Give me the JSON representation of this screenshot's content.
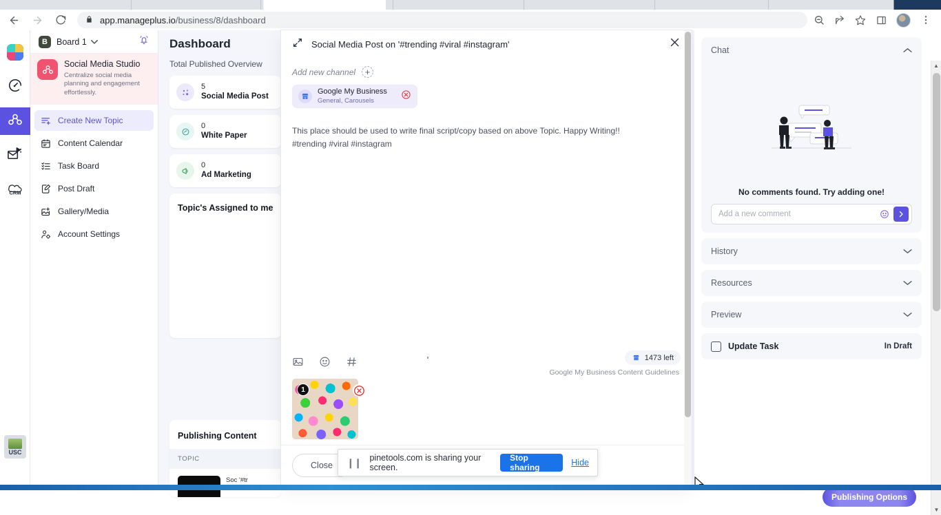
{
  "browser": {
    "url_host": "app.manageplus.io",
    "url_path": "/business/8/dashboard",
    "back_icon": "back-arrow-icon",
    "forward_icon": "forward-arrow-icon",
    "reload_icon": "reload-icon",
    "lock_icon": "lock-icon",
    "zoom_icon": "zoom-out-icon",
    "share_icon": "share-icon",
    "bookmark_icon": "star-icon",
    "sidepanel_icon": "side-panel-icon",
    "profile_icon": "profile-avatar-icon",
    "menu_icon": "three-dot-menu-icon"
  },
  "rail": {
    "items": [
      {
        "icon": "apps-grid-logo-icon",
        "label": "Apps"
      },
      {
        "icon": "speedometer-icon",
        "label": "Dashboard"
      },
      {
        "icon": "social-studio-icon",
        "label": "Social Media Studio"
      },
      {
        "icon": "email-campaign-icon",
        "label": "Email Marketing"
      },
      {
        "icon": "crm-icon",
        "label": "CRM"
      }
    ],
    "bottom_label": "USC"
  },
  "sidebar": {
    "board": {
      "badge": "B",
      "name": "Board 1",
      "caret_icon": "chevron-down-icon",
      "bell_icon": "notification-bell-icon"
    },
    "studio": {
      "icon": "social-studio-icon",
      "title": "Social Media Studio",
      "subtitle": "Centralize social media planning and engagement effortlessly."
    },
    "items": [
      {
        "label": "Create New Topic",
        "icon": "create-topic-icon",
        "active": true
      },
      {
        "label": "Content Calendar",
        "icon": "calendar-icon",
        "active": false
      },
      {
        "label": "Task Board",
        "icon": "task-list-icon",
        "active": false
      },
      {
        "label": "Post Draft",
        "icon": "draft-edit-icon",
        "active": false
      },
      {
        "label": "Gallery/Media",
        "icon": "gallery-add-icon",
        "active": false
      },
      {
        "label": "Account Settings",
        "icon": "account-settings-icon",
        "active": false
      }
    ]
  },
  "dashboard": {
    "title": "Dashboard",
    "subtitle": "Total Published Overview",
    "stats": [
      {
        "count": "5",
        "label": "Social Media Post",
        "icon": "social-post-icon",
        "bg": "#ece9fb",
        "fg": "#6b63e6"
      },
      {
        "count": "0",
        "label": "White Paper",
        "icon": "white-paper-icon",
        "bg": "#e6f6f2",
        "fg": "#3aa08e"
      },
      {
        "count": "0",
        "label": "Ad Marketing",
        "icon": "ad-marketing-icon",
        "bg": "#e6f6ea",
        "fg": "#3f9d5e"
      }
    ],
    "assigned_panel_title": "Topic's Assigned to me",
    "publishing_panel_title": "Publishing Content",
    "publishing_column_header": "TOPIC",
    "publishing_row_text": "Soc '#tr"
  },
  "modal": {
    "expand_icon": "expand-diagonal-icon",
    "title": "Social Media Post on '#trending #viral #instagram'",
    "close_icon": "close-x-icon",
    "add_channel_label": "Add new channel",
    "add_channel_icon": "plus-icon",
    "channel": {
      "icon": "google-my-business-icon",
      "name": "Google My Business",
      "subtitle": "General, Carousels",
      "remove_icon": "remove-circle-icon"
    },
    "editor_line1": "This place should be used to write final script/copy based on above Topic. Happy Writing!!",
    "editor_line2": "#trending #viral #instagram",
    "toolbar": [
      {
        "icon": "image-insert-icon"
      },
      {
        "icon": "emoji-icon"
      },
      {
        "icon": "hashtag-icon"
      }
    ],
    "counter_text": "1473 left",
    "counter_icon": "google-my-business-icon",
    "guidelines_link": "Google My Business Content Guidelines",
    "media": {
      "index": "1",
      "remove_icon": "remove-circle-icon"
    },
    "close_button": "Close"
  },
  "right": {
    "sections": [
      {
        "label": "Chat",
        "caret": "chevron-up-icon",
        "expanded": true
      },
      {
        "label": "History",
        "caret": "chevron-down-icon",
        "expanded": false
      },
      {
        "label": "Resources",
        "caret": "chevron-down-icon",
        "expanded": false
      },
      {
        "label": "Preview",
        "caret": "chevron-down-icon",
        "expanded": false
      }
    ],
    "chat": {
      "empty_illustration": "two-people-chat-illustration",
      "empty_text": "No comments found. Try adding one!",
      "input_placeholder": "Add a new comment",
      "emoji_icon": "emoji-icon",
      "send_icon": "send-arrow-icon"
    },
    "task": {
      "checkbox_icon": "checkbox-unchecked-icon",
      "label": "Update Task",
      "status": "In Draft"
    },
    "publish_button": "Publishing Options"
  },
  "share_bar": {
    "pause_icon": "pause-icon",
    "text": "pinetools.com is sharing your screen.",
    "stop_label": "Stop sharing",
    "hide_label": "Hide"
  },
  "colors": {
    "accent": "#5b53e0",
    "accent_light": "#edecfd",
    "danger": "#e13a3a",
    "studio_pink": "#ef5370",
    "chrome_blue": "#1a73e8"
  }
}
